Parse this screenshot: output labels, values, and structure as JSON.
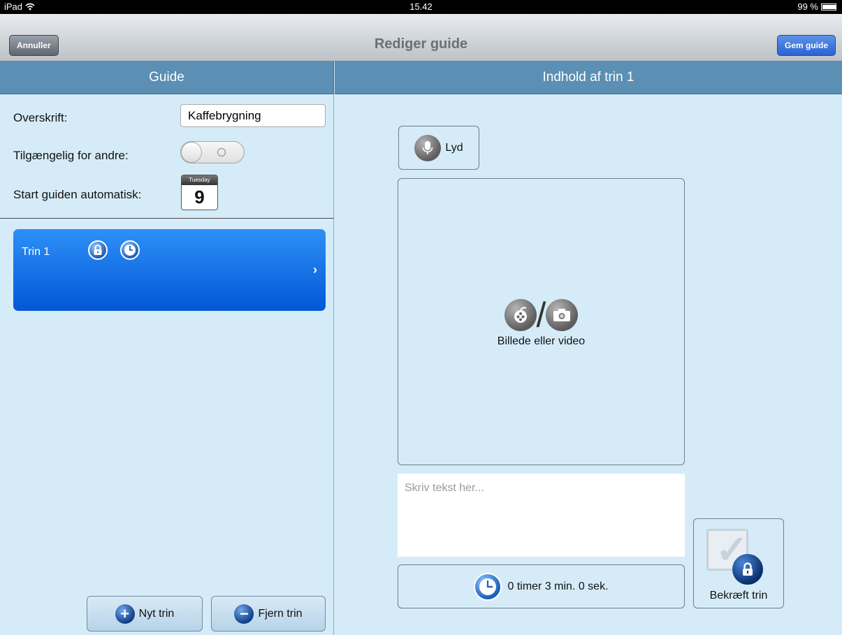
{
  "status_bar": {
    "device": "iPad",
    "time": "15.42",
    "battery": "99 %"
  },
  "navbar": {
    "title": "Rediger guide",
    "cancel_label": "Annuller",
    "save_label": "Gem guide"
  },
  "left_panel": {
    "header": "Guide",
    "title_label": "Overskrift:",
    "title_value": "Kaffebrygning",
    "available_label": "Tilgængelig for andre:",
    "available_on": false,
    "autostart_label": "Start guiden automatisk:",
    "calendar_weekday": "Tuesday",
    "calendar_day": "9",
    "steps": [
      {
        "label": "Trin 1",
        "icons": [
          "lock-icon",
          "clock-icon"
        ],
        "selected": true
      }
    ],
    "new_step_label": "Nyt trin",
    "remove_step_label": "Fjern trin"
  },
  "right_panel": {
    "header": "Indhold af trin 1",
    "audio_label": "Lyd",
    "media_label": "Billede eller video",
    "text_placeholder": "Skriv tekst her...",
    "timer_label": "0 timer 3 min. 0 sek.",
    "confirm_label": "Bekræft trin"
  },
  "colors": {
    "section_header": "#5b8fb3",
    "panel_bg": "#d5ecf8",
    "selected_row": "#0a6ae8",
    "save_button": "#2a63d4"
  }
}
